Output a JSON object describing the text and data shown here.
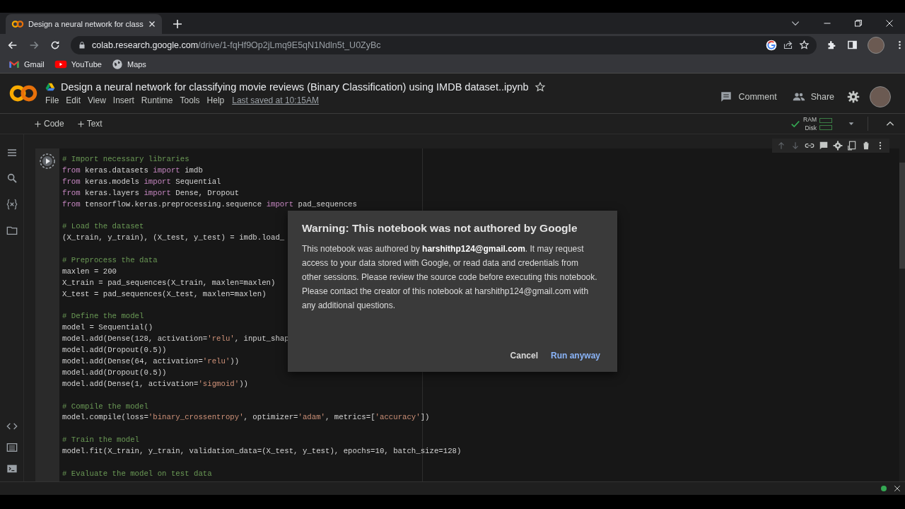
{
  "browser": {
    "tab": {
      "title": "Design a neural network for class",
      "selected": true
    },
    "address": {
      "host": "colab.research.google.com",
      "path": "/drive/1-fqHf9Op2jLmq9E5qN1Ndln5t_U0ZyBc"
    },
    "bookmarks": [
      {
        "label": "Gmail"
      },
      {
        "label": "YouTube"
      },
      {
        "label": "Maps"
      }
    ]
  },
  "notebook": {
    "title": "Design a neural network for classifying movie reviews (Binary Classification) using IMDB dataset..ipynb",
    "starred": false,
    "menu": [
      "File",
      "Edit",
      "View",
      "Insert",
      "Runtime",
      "Tools",
      "Help"
    ],
    "last_saved": "Last saved at 10:15AM",
    "actions": [
      "Comment",
      "Share"
    ]
  },
  "toolbar": {
    "insert": [
      "Code",
      "Text"
    ],
    "connected": true,
    "resources": [
      "RAM",
      "Disk"
    ]
  },
  "cell": {
    "lines": [
      {
        "kind": "code",
        "segments": [
          {
            "kind": "comment",
            "text": "# Import necessary libraries"
          }
        ]
      },
      {
        "kind": "code",
        "segments": [
          {
            "kind": "keyword",
            "text": "from"
          },
          {
            "kind": "plain",
            "text": " keras.datasets "
          },
          {
            "kind": "keyword",
            "text": "import"
          },
          {
            "kind": "plain",
            "text": " imdb"
          }
        ]
      },
      {
        "kind": "code",
        "segments": [
          {
            "kind": "keyword",
            "text": "from"
          },
          {
            "kind": "plain",
            "text": " keras.models "
          },
          {
            "kind": "keyword",
            "text": "import"
          },
          {
            "kind": "plain",
            "text": " Sequential"
          }
        ]
      },
      {
        "kind": "code",
        "segments": [
          {
            "kind": "keyword",
            "text": "from"
          },
          {
            "kind": "plain",
            "text": " keras.layers "
          },
          {
            "kind": "keyword",
            "text": "import"
          },
          {
            "kind": "plain",
            "text": " Dense, Dropout"
          }
        ]
      },
      {
        "kind": "code",
        "segments": [
          {
            "kind": "keyword",
            "text": "from"
          },
          {
            "kind": "plain",
            "text": " tensorflow.keras.preprocessing.sequence "
          },
          {
            "kind": "keyword",
            "text": "import"
          },
          {
            "kind": "plain",
            "text": " pad_sequences"
          }
        ]
      },
      {
        "kind": "blank"
      },
      {
        "kind": "code",
        "segments": [
          {
            "kind": "comment",
            "text": "# Load the dataset"
          }
        ]
      },
      {
        "kind": "code",
        "segments": [
          {
            "kind": "plain",
            "text": "(X_train, y_train), (X_test, y_test) = imdb.load_"
          }
        ]
      },
      {
        "kind": "blank"
      },
      {
        "kind": "code",
        "segments": [
          {
            "kind": "comment",
            "text": "# Preprocess the data"
          }
        ]
      },
      {
        "kind": "code",
        "segments": [
          {
            "kind": "plain",
            "text": "maxlen = 200"
          }
        ]
      },
      {
        "kind": "code",
        "segments": [
          {
            "kind": "plain",
            "text": "X_train = pad_sequences(X_train, maxlen=maxlen)"
          }
        ]
      },
      {
        "kind": "code",
        "segments": [
          {
            "kind": "plain",
            "text": "X_test = pad_sequences(X_test, maxlen=maxlen)"
          }
        ]
      },
      {
        "kind": "blank"
      },
      {
        "kind": "code",
        "segments": [
          {
            "kind": "comment",
            "text": "# Define the model"
          }
        ]
      },
      {
        "kind": "code",
        "segments": [
          {
            "kind": "plain",
            "text": "model = Sequential()"
          }
        ]
      },
      {
        "kind": "code",
        "segments": [
          {
            "kind": "plain",
            "text": "model.add(Dense(128, activation="
          },
          {
            "kind": "string",
            "text": "'relu'"
          },
          {
            "kind": "plain",
            "text": ", input_shap"
          }
        ]
      },
      {
        "kind": "code",
        "segments": [
          {
            "kind": "plain",
            "text": "model.add(Dropout(0.5))"
          }
        ]
      },
      {
        "kind": "code",
        "segments": [
          {
            "kind": "plain",
            "text": "model.add(Dense(64, activation="
          },
          {
            "kind": "string",
            "text": "'relu'"
          },
          {
            "kind": "plain",
            "text": "))"
          }
        ]
      },
      {
        "kind": "code",
        "segments": [
          {
            "kind": "plain",
            "text": "model.add(Dropout(0.5))"
          }
        ]
      },
      {
        "kind": "code",
        "segments": [
          {
            "kind": "plain",
            "text": "model.add(Dense(1, activation="
          },
          {
            "kind": "string",
            "text": "'sigmoid'"
          },
          {
            "kind": "plain",
            "text": "))"
          }
        ]
      },
      {
        "kind": "blank"
      },
      {
        "kind": "code",
        "segments": [
          {
            "kind": "comment",
            "text": "# Compile the model"
          }
        ]
      },
      {
        "kind": "code",
        "segments": [
          {
            "kind": "plain",
            "text": "model.compile(loss="
          },
          {
            "kind": "string",
            "text": "'binary_crossentropy'"
          },
          {
            "kind": "plain",
            "text": ", optimizer="
          },
          {
            "kind": "string",
            "text": "'adam'"
          },
          {
            "kind": "plain",
            "text": ", metrics=["
          },
          {
            "kind": "string",
            "text": "'accuracy'"
          },
          {
            "kind": "plain",
            "text": "])"
          }
        ]
      },
      {
        "kind": "blank"
      },
      {
        "kind": "code",
        "segments": [
          {
            "kind": "comment",
            "text": "# Train the model"
          }
        ]
      },
      {
        "kind": "code",
        "segments": [
          {
            "kind": "plain",
            "text": "model.fit(X_train, y_train, validation_data=(X_test, y_test), epochs=10, batch_size=128)"
          }
        ]
      },
      {
        "kind": "blank"
      },
      {
        "kind": "code",
        "segments": [
          {
            "kind": "comment",
            "text": "# Evaluate the model on test data"
          }
        ]
      }
    ]
  },
  "dialog": {
    "title": "Warning: This notebook was not authored by Google",
    "body": "This notebook was authored by **harshithp124@gmail.com**. It may request access to your data stored with Google, or read data and credentials from other sessions. Please review the source code before executing this notebook. Please contact the creator of this notebook at harshithp124@gmail.com with any additional questions.",
    "buttons": [
      {
        "label": "Cancel",
        "kind": "secondary"
      },
      {
        "label": "Run anyway",
        "kind": "primary"
      }
    ]
  }
}
